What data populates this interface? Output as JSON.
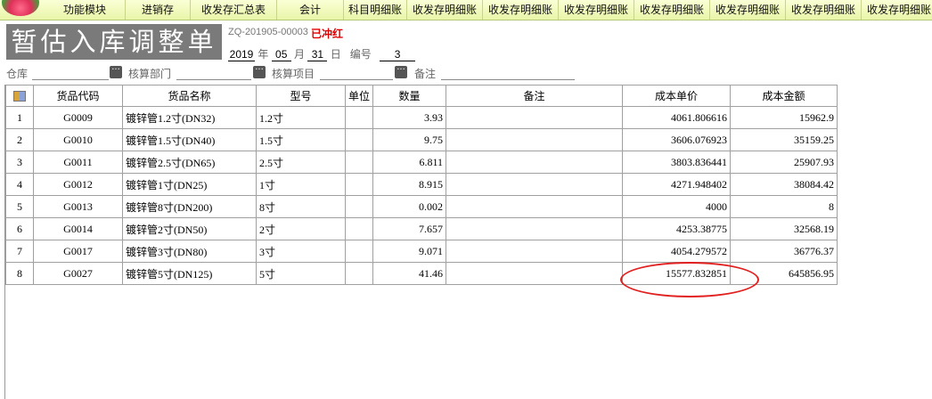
{
  "menu": {
    "tabs": [
      "功能模块",
      "进销存",
      "收发存汇总表",
      "会计",
      "科目明细账",
      "收发存明细账",
      "收发存明细账",
      "收发存明细账",
      "收发存明细账",
      "收发存明细账",
      "收发存明细账",
      "收发存明细账"
    ]
  },
  "doc": {
    "title": "暂估入库调整单",
    "number": "ZQ-201905-00003",
    "status": "已冲红",
    "year": "2019",
    "year_label": "年",
    "month": "05",
    "month_label": "月",
    "day": "31",
    "day_label": "日",
    "serial_label": "编号",
    "serial": "3"
  },
  "filters": {
    "warehouse": "仓库",
    "dept": "核算部门",
    "project": "核算项目",
    "remark": "备注"
  },
  "table": {
    "headers": [
      "货品代码",
      "货品名称",
      "型号",
      "单位",
      "数量",
      "备注",
      "成本单价",
      "成本金额"
    ],
    "rows": [
      {
        "no": "1",
        "code": "G0009",
        "name": "镀锌管1.2寸(DN32)",
        "model": "1.2寸",
        "unit": "",
        "qty": "3.93",
        "remark": "",
        "price": "4061.806616",
        "amount": "15962.9"
      },
      {
        "no": "2",
        "code": "G0010",
        "name": "镀锌管1.5寸(DN40)",
        "model": "1.5寸",
        "unit": "",
        "qty": "9.75",
        "remark": "",
        "price": "3606.076923",
        "amount": "35159.25"
      },
      {
        "no": "3",
        "code": "G0011",
        "name": "镀锌管2.5寸(DN65)",
        "model": "2.5寸",
        "unit": "",
        "qty": "6.811",
        "remark": "",
        "price": "3803.836441",
        "amount": "25907.93"
      },
      {
        "no": "4",
        "code": "G0012",
        "name": "镀锌管1寸(DN25)",
        "model": "1寸",
        "unit": "",
        "qty": "8.915",
        "remark": "",
        "price": "4271.948402",
        "amount": "38084.42"
      },
      {
        "no": "5",
        "code": "G0013",
        "name": "镀锌管8寸(DN200)",
        "model": "8寸",
        "unit": "",
        "qty": "0.002",
        "remark": "",
        "price": "4000",
        "amount": "8"
      },
      {
        "no": "6",
        "code": "G0014",
        "name": "镀锌管2寸(DN50)",
        "model": "2寸",
        "unit": "",
        "qty": "7.657",
        "remark": "",
        "price": "4253.38775",
        "amount": "32568.19"
      },
      {
        "no": "7",
        "code": "G0017",
        "name": "镀锌管3寸(DN80)",
        "model": "3寸",
        "unit": "",
        "qty": "9.071",
        "remark": "",
        "price": "4054.279572",
        "amount": "36776.37"
      },
      {
        "no": "8",
        "code": "G0027",
        "name": "镀锌管5寸(DN125)",
        "model": "5寸",
        "unit": "",
        "qty": "41.46",
        "remark": "",
        "price": "15577.832851",
        "amount": "645856.95"
      }
    ]
  },
  "colors": {
    "accent_red": "#e22020",
    "title_bg": "#7a7a7a",
    "menu_bg": "#eef7b8"
  }
}
